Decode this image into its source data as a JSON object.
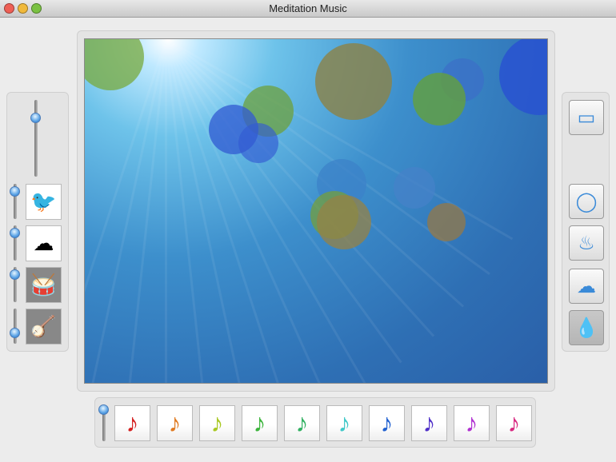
{
  "window": {
    "title": "Meditation Music"
  },
  "sounds": [
    {
      "name": "hummingbird",
      "icon": "🐦",
      "volume": 0.9
    },
    {
      "name": "sky",
      "icon": "☁",
      "volume": 0.9
    },
    {
      "name": "tabla",
      "icon": "🥁",
      "volume": 0.9
    },
    {
      "name": "sitar",
      "icon": "🪕",
      "volume": 0.3
    }
  ],
  "master_volume": 0.8,
  "notes_volume": 0.9,
  "notes": [
    {
      "color": "#d42020"
    },
    {
      "color": "#e07a20"
    },
    {
      "color": "#a8c820"
    },
    {
      "color": "#3cb43c"
    },
    {
      "color": "#30b060"
    },
    {
      "color": "#40c8c8"
    },
    {
      "color": "#2060d0"
    },
    {
      "color": "#5030c8"
    },
    {
      "color": "#b030d0"
    },
    {
      "color": "#d82880"
    }
  ],
  "shapes": [
    {
      "name": "screen",
      "glyph": "▭"
    },
    {
      "name": "circle",
      "glyph": "◯"
    },
    {
      "name": "flame",
      "glyph": "♨"
    },
    {
      "name": "cloud",
      "glyph": "☁"
    },
    {
      "name": "drop",
      "glyph": "💧",
      "selected": true
    }
  ]
}
